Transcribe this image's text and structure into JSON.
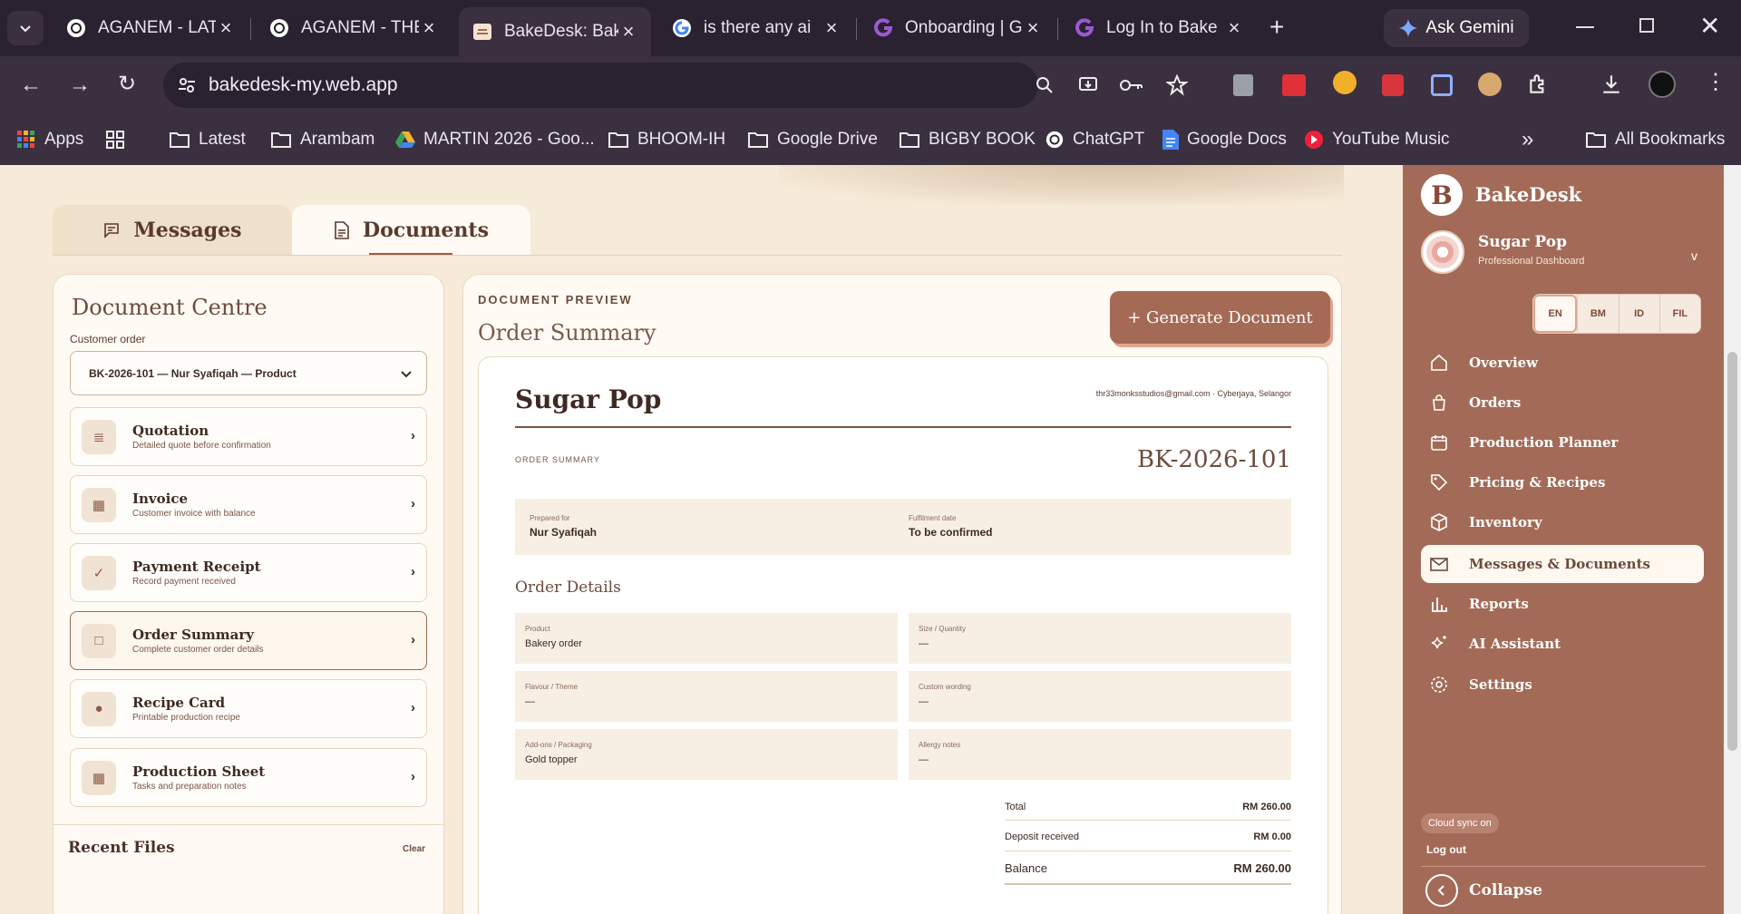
{
  "browser": {
    "tabs": [
      {
        "label": "AGANEM - LATE",
        "favicon": "chatgpt-icon"
      },
      {
        "label": "AGANEM - THE",
        "favicon": "chatgpt-icon"
      },
      {
        "label": "BakeDesk: Bak",
        "favicon": "bakedesk-icon",
        "active": true
      },
      {
        "label": "is there any ai",
        "favicon": "google-icon"
      },
      {
        "label": "Onboarding | G",
        "favicon": "g-icon"
      },
      {
        "label": "Log In to Bake",
        "favicon": "g-icon"
      }
    ],
    "gemini_label": "Ask Gemini",
    "url": "bakedesk-my.web.app",
    "bookmarks": [
      "Apps",
      "Latest",
      "Arambam",
      "MARTIN 2026 - Goo...",
      "BHOOM-IH",
      "Google Drive",
      "BIGBY BOOK",
      "ChatGPT",
      "Google Docs",
      "YouTube Music",
      "All Bookmarks"
    ]
  },
  "page": {
    "tabs": {
      "messages": "Messages",
      "documents": "Documents"
    },
    "doc_centre": {
      "title": "Document Centre",
      "order_label": "Customer order",
      "order_value": "BK-2026-101 — Nur Syafiqah — Product",
      "cards": [
        {
          "title": "Quotation",
          "subtitle": "Detailed quote before confirmation",
          "icon": "≣"
        },
        {
          "title": "Invoice",
          "subtitle": "Customer invoice with balance",
          "icon": "▦"
        },
        {
          "title": "Payment Receipt",
          "subtitle": "Record payment received",
          "icon": "✓"
        },
        {
          "title": "Order Summary",
          "subtitle": "Complete customer order details",
          "icon": "□"
        },
        {
          "title": "Recipe Card",
          "subtitle": "Printable production recipe",
          "icon": "●"
        },
        {
          "title": "Production Sheet",
          "subtitle": "Tasks and preparation notes",
          "icon": "▦"
        }
      ],
      "recent_files": "Recent Files",
      "clear": "Clear"
    },
    "preview": {
      "kicker": "DOCUMENT PREVIEW",
      "title": "Order Summary",
      "generate_button": "+ Generate Document",
      "sheet": {
        "business": "Sugar Pop",
        "contact": "thr33monksstudios@gmail.com · Cyberjaya, Selangor",
        "doc_label": "ORDER SUMMARY",
        "order_no": "BK-2026-101",
        "prepared_for_label": "Prepared for",
        "prepared_for": "Nur Syafiqah",
        "fulfilment_label": "Fulfilment date",
        "fulfilment": "To be confirmed",
        "details_heading": "Order Details",
        "details": [
          {
            "label": "Product",
            "value": "Bakery order"
          },
          {
            "label": "Size / Quantity",
            "value": "—"
          },
          {
            "label": "Flavour / Theme",
            "value": "—"
          },
          {
            "label": "Custom wording",
            "value": "—"
          },
          {
            "label": "Add-ons / Packaging",
            "value": "Gold topper"
          },
          {
            "label": "Allergy notes",
            "value": "—"
          }
        ],
        "totals": {
          "total_label": "Total",
          "total": "RM 260.00",
          "deposit_label": "Deposit received",
          "deposit": "RM 0.00",
          "balance_label": "Balance",
          "balance": "RM 260.00"
        }
      }
    }
  },
  "sidebar": {
    "brand": "BakeDesk",
    "logo_letter": "B",
    "business_name": "Sugar Pop",
    "business_sub": "Professional Dashboard",
    "caret": "v",
    "languages": [
      "EN",
      "BM",
      "ID",
      "FIL"
    ],
    "nav": [
      {
        "label": "Overview",
        "icon": "home-icon"
      },
      {
        "label": "Orders",
        "icon": "bag-icon"
      },
      {
        "label": "Production Planner",
        "icon": "calendar-icon"
      },
      {
        "label": "Pricing & Recipes",
        "icon": "tag-icon"
      },
      {
        "label": "Inventory",
        "icon": "box-icon"
      },
      {
        "label": "Messages & Documents",
        "icon": "mail-icon",
        "active": true
      },
      {
        "label": "Reports",
        "icon": "chart-icon"
      },
      {
        "label": "AI Assistant",
        "icon": "sparkle-icon"
      },
      {
        "label": "Settings",
        "icon": "gear-icon"
      }
    ],
    "sync": "Cloud sync on",
    "logout": "Log out",
    "collapse": "Collapse"
  }
}
